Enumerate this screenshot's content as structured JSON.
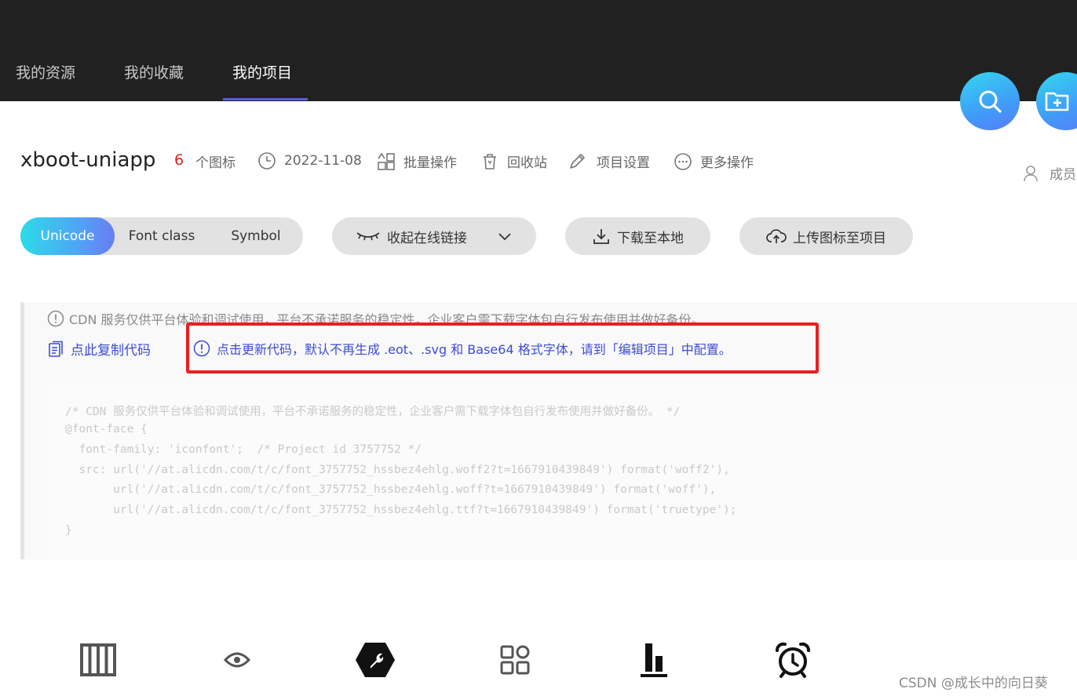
{
  "nav": {
    "tabs": [
      {
        "label": "我的资源"
      },
      {
        "label": "我的收藏"
      },
      {
        "label": "我的项目"
      }
    ]
  },
  "project": {
    "title": "xboot-uniapp",
    "icon_count": "6",
    "icon_count_suffix": "个图标",
    "date": "2022-11-08",
    "batch_ops": "批量操作",
    "recycle_bin": "回收站",
    "settings": "项目设置",
    "more_ops": "更多操作",
    "members": "成员"
  },
  "toolbar": {
    "formats": [
      {
        "label": "Unicode"
      },
      {
        "label": "Font class"
      },
      {
        "label": "Symbol"
      }
    ],
    "collapse_link": "收起在线链接",
    "download": "下载至本地",
    "upload": "上传图标至项目"
  },
  "panel": {
    "notice": "CDN 服务仅供平台体验和调试使用，平台不承诺服务的稳定性，企业客户需下载字体包自行发布使用并做好备份。",
    "copy_code": "点此复制代码",
    "update_code": "点击更新代码，默认不再生成 .eot、.svg 和 Base64 格式字体，请到「编辑项目」中配置。"
  },
  "code_lines": [
    "/* CDN 服务仅供平台体验和调试使用，平台不承诺服务的稳定性，企业客户需下载字体包自行发布使用并做好备份。 */",
    "@font-face {",
    "  font-family: 'iconfont';  /* Project id 3757752 */",
    "  src: url('//at.alicdn.com/t/c/font_3757752_hssbez4ehlg.woff2?t=1667910439849') format('woff2'),",
    "       url('//at.alicdn.com/t/c/font_3757752_hssbez4ehlg.woff?t=1667910439849') format('woff'),",
    "       url('//at.alicdn.com/t/c/font_3757752_hssbez4ehlg.ttf?t=1667910439849') format('truetype');",
    "}"
  ],
  "icons": [
    "grid-columns-icon",
    "eye-icon",
    "wrench-icon",
    "apps-icon",
    "bar-chart-icon",
    "alarm-clock-icon"
  ],
  "colors": {
    "accent_blue": "#3d4bd6",
    "count_red": "#e02020",
    "highlight_box": "#e6201f",
    "topbar": "#212121"
  },
  "watermark": "CSDN @成长中的向日葵"
}
